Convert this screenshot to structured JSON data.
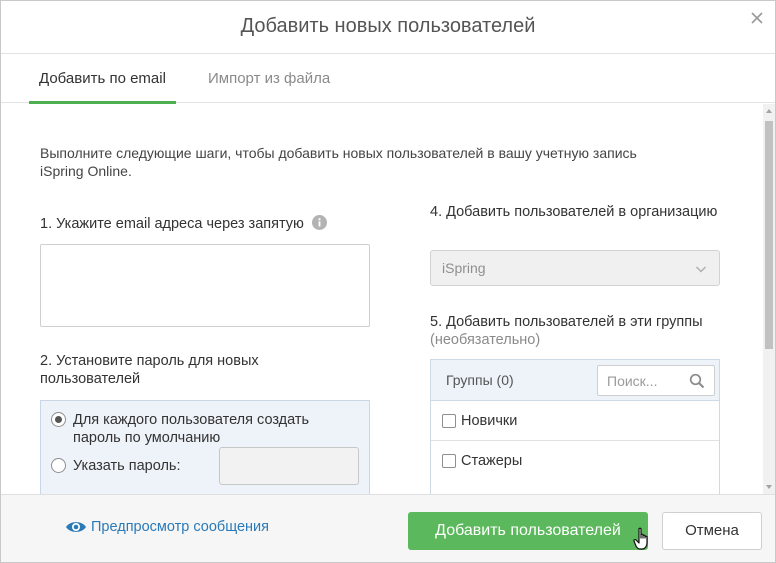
{
  "dialog": {
    "title": "Добавить новых пользователей",
    "close_icon": "close-icon"
  },
  "tabs": [
    {
      "label": "Добавить по email",
      "active": true
    },
    {
      "label": "Импорт из файла",
      "active": false
    }
  ],
  "intro": "Выполните следующие шаги, чтобы добавить новых пользователей в вашу учетную запись iSpring Online.",
  "step1": {
    "label": "1. Укажите email адреса через запятую",
    "icon": "info-icon",
    "value": ""
  },
  "step2": {
    "label": "2. Установите пароль для новых пользователей",
    "options": [
      {
        "label": "Для каждого пользователя создать пароль по умолчанию",
        "selected": true
      },
      {
        "label": "Указать пароль:",
        "selected": false
      }
    ],
    "password_value": ""
  },
  "step4": {
    "label": "4. Добавить пользователей в организацию",
    "selected": "iSpring",
    "icon": "chevron-down-icon"
  },
  "step5": {
    "label": "5. Добавить пользователей в эти группы",
    "optional": "(необязательно)",
    "groups_title": "Группы (0)",
    "search_placeholder": "Поиск...",
    "search_icon": "search-icon",
    "groups": [
      {
        "name": "Новички",
        "checked": false
      },
      {
        "name": "Стажеры",
        "checked": false
      }
    ]
  },
  "footer": {
    "preview_label": "Предпросмотр сообщения",
    "preview_icon": "eye-icon",
    "add_label": "Добавить пользователей",
    "cancel_label": "Отмена"
  },
  "colors": {
    "accent_green": "#5cb85c",
    "tab_underline": "#4caf50",
    "link_blue": "#2a7ab8",
    "panel_blue": "#eef3f9"
  }
}
